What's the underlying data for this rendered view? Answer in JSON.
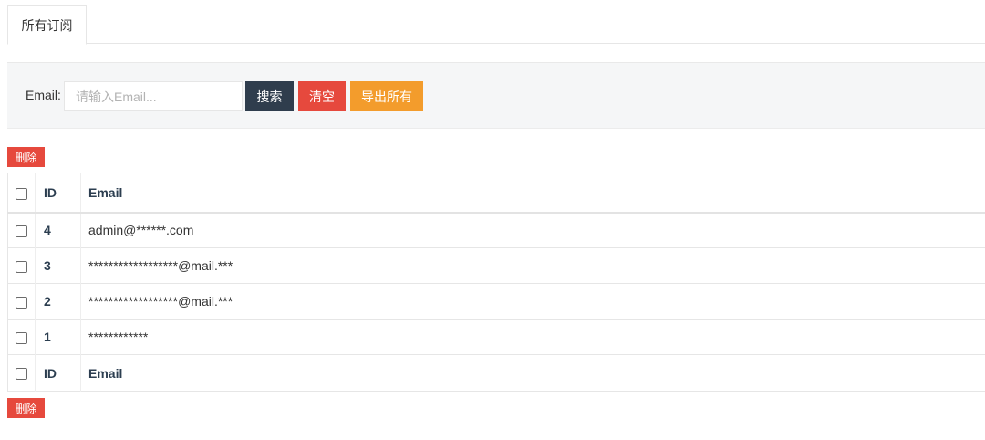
{
  "tabs": [
    {
      "label": "所有订阅"
    }
  ],
  "search": {
    "label": "Email:",
    "placeholder": "请输入Email...",
    "value": ""
  },
  "buttons": {
    "search": "搜索",
    "clear": "清空",
    "export": "导出所有",
    "delete": "删除"
  },
  "table": {
    "columns": [
      "ID",
      "Email"
    ],
    "rows": [
      {
        "id": "4",
        "email": "admin@******.com"
      },
      {
        "id": "3",
        "email": "******************@mail.***"
      },
      {
        "id": "2",
        "email": "******************@mail.***"
      },
      {
        "id": "1",
        "email": "************"
      }
    ]
  },
  "colors": {
    "search_button": "#2f3d4d",
    "clear_button": "#e6493d",
    "export_button": "#f39c2c",
    "delete_button": "#e6493d"
  }
}
